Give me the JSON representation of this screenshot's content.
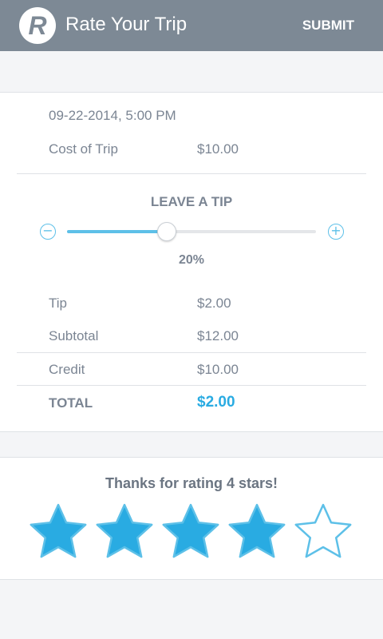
{
  "app": {
    "title": "Rate Your Trip",
    "logo_letter": "R",
    "submit_label": "SUBMIT"
  },
  "trip": {
    "datetime": "09-22-2014, 5:00 PM",
    "cost_label": "Cost of Trip",
    "cost_value": "$10.00"
  },
  "tip": {
    "title": "LEAVE A TIP",
    "decrease_icon": "minus-circle-icon",
    "increase_icon": "plus-circle-icon",
    "decrease_glyph": "−",
    "increase_glyph": "+",
    "percent_label": "20%",
    "slider_level": 0.4
  },
  "summary": {
    "tip_label": "Tip",
    "tip_value": "$2.00",
    "subtotal_label": "Subtotal",
    "subtotal_value": "$12.00",
    "credit_label": "Credit",
    "credit_value": "$10.00",
    "total_label": "TOTAL",
    "total_value": "$2.00"
  },
  "rating": {
    "message": "Thanks for rating 4 stars!",
    "value": 4,
    "max": 5,
    "star_icon": "star-icon"
  },
  "colors": {
    "appbar": "#7d8995",
    "accent": "#29abe2",
    "star_fill": "#29abe2",
    "star_outline": "#5dc0e8",
    "text": "#7b8593"
  }
}
